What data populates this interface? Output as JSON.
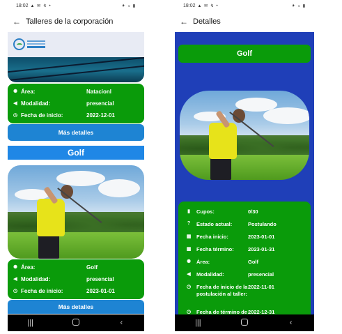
{
  "left": {
    "status": {
      "time": "18:02",
      "left_icons": "▲ ✉ ↯ •",
      "right_icons": "✈ ◒ ▮"
    },
    "appbar": {
      "back_icon": "arrow-left-icon",
      "title": "Talleres de la corporación"
    },
    "banner": {
      "logo": "logo-icon"
    },
    "card1": {
      "rows": [
        {
          "icon": "globe-icon",
          "label": "Área:",
          "value": "Natacionl"
        },
        {
          "icon": "megaphone-icon",
          "label": "Modalidad:",
          "value": "presencial"
        },
        {
          "icon": "clock-icon",
          "label": "Fecha de inicio:",
          "value": "2022-12-01"
        }
      ],
      "more_label": "Más detalles"
    },
    "card2": {
      "title": "Golf",
      "rows": [
        {
          "icon": "globe-icon",
          "label": "Área:",
          "value": "Golf"
        },
        {
          "icon": "megaphone-icon",
          "label": "Modalidad:",
          "value": "presencial"
        },
        {
          "icon": "clock-icon",
          "label": "Fecha de inicio:",
          "value": "2023-01-01"
        }
      ],
      "more_label": "Más detalles"
    },
    "navbar": {
      "recents": "|||",
      "home": "",
      "back": "‹"
    }
  },
  "right": {
    "status": {
      "time": "18:02",
      "left_icons": "▲ ✉ ↯ •",
      "right_icons": "✈ ◒ ▮"
    },
    "appbar": {
      "back_icon": "arrow-left-icon",
      "title": "Detalles"
    },
    "heading": "Golf",
    "rows": [
      {
        "icon": "clipboard-icon",
        "label": "Cupos:",
        "value": "0/30"
      },
      {
        "icon": "question-icon",
        "label": "Estado actual:",
        "value": "Postulando"
      },
      {
        "icon": "calendar-icon",
        "label": "Fecha inicio:",
        "value": "2023-01-01"
      },
      {
        "icon": "calendar-icon",
        "label": "Fecha término:",
        "value": "2023-01-31"
      },
      {
        "icon": "globe-icon",
        "label": "Área:",
        "value": "Golf"
      },
      {
        "icon": "megaphone-icon",
        "label": "Modalidad:",
        "value": "presencial"
      },
      {
        "icon": "clock-icon",
        "label": "Fecha de inicio de la postulación al taller:",
        "value": "2022-11-01"
      },
      {
        "icon": "clock-icon",
        "label": "Fecha de término de",
        "value": "2022-12-31"
      }
    ],
    "navbar": {
      "recents": "|||",
      "home": "",
      "back": "‹"
    }
  }
}
